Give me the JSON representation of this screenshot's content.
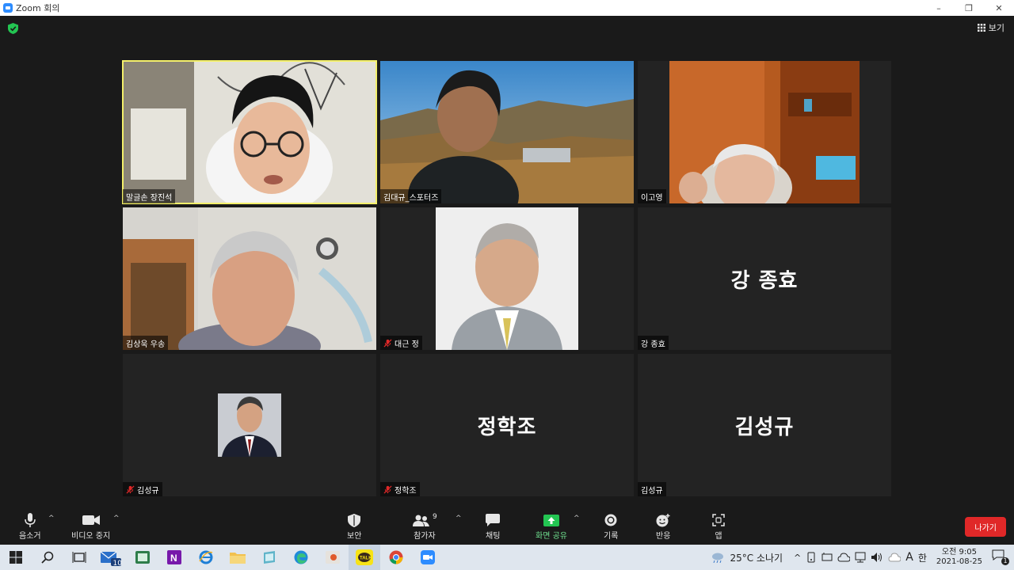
{
  "window": {
    "title": "Zoom 회의",
    "minimize": "–",
    "maximize": "❐",
    "close": "✕"
  },
  "header": {
    "view_label": "보기"
  },
  "tiles": [
    {
      "name": "말글손 장진석",
      "type": "video",
      "active": true,
      "muted": false
    },
    {
      "name": "김대규_스포터즈",
      "type": "video",
      "active": false,
      "muted": false
    },
    {
      "name": "이고영",
      "type": "video",
      "active": false,
      "muted": false
    },
    {
      "name": "김상욱 우송",
      "type": "video",
      "active": false,
      "muted": false
    },
    {
      "name": "대근 정",
      "type": "photo",
      "active": false,
      "muted": true
    },
    {
      "name": "강 종효",
      "type": "name",
      "big": "강 종효",
      "active": false,
      "muted": false
    },
    {
      "name": "김성규",
      "type": "photo-small",
      "active": false,
      "muted": true
    },
    {
      "name": "정학조",
      "type": "name",
      "big": "정학조",
      "active": false,
      "muted": true
    },
    {
      "name": "김성규",
      "type": "name",
      "big": "김성규",
      "active": false,
      "muted": false
    }
  ],
  "toolbar": {
    "mute": "음소거",
    "video": "비디오 중지",
    "security": "보안",
    "participants": "참가자",
    "participants_count": "9",
    "chat": "채팅",
    "share": "화면 공유",
    "record": "기록",
    "reactions": "반응",
    "apps": "앱",
    "leave": "나가기"
  },
  "taskbar": {
    "mail_badge": "10",
    "weather": "25°C 소나기",
    "ime": "A",
    "lang": "한",
    "time": "오전 9:05",
    "date": "2021-08-25",
    "notif_count": "1"
  },
  "colors": {
    "accent_active": "#f4f06b",
    "leave": "#e02828",
    "share": "#23c552",
    "muted": "#e02828"
  }
}
